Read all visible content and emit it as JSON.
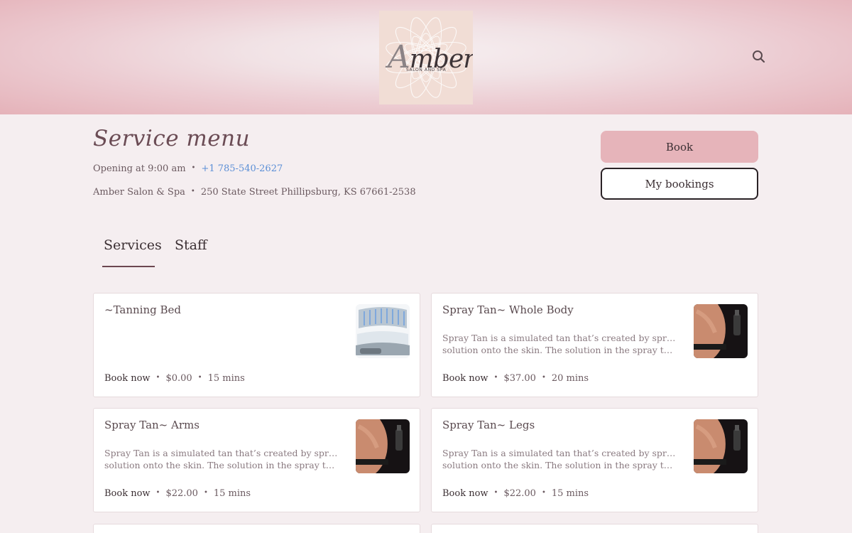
{
  "header": {
    "logo_word": "mber",
    "logo_initial": "A",
    "logo_sub": "SALON AND SPA"
  },
  "service": {
    "title": "Service menu",
    "opening": "Opening at 9:00 am",
    "phone": "+1 785-540-2627",
    "business_name": "Amber Salon & Spa",
    "address": "250 State Street Phillipsburg, KS 67661-2538",
    "separator": "•"
  },
  "actions": {
    "book": "Book",
    "my_bookings": "My bookings"
  },
  "tabs": [
    {
      "label": "Services",
      "active": true
    },
    {
      "label": "Staff",
      "active": false
    }
  ],
  "cards": [
    {
      "name": "~Tanning Bed",
      "desc_line1": "",
      "desc_line2": "",
      "book": "Book now",
      "price": "$0.00",
      "duration": "15 mins",
      "image": "tanning-bed"
    },
    {
      "name": "Spray Tan~ Whole Body",
      "desc_line1": "Spray Tan is a simulated tan that’s created by spraying a",
      "desc_line2": "solution onto the skin. The solution in the spray tan reac…",
      "book": "Book now",
      "price": "$37.00",
      "duration": "20 mins",
      "image": "spray-tan"
    },
    {
      "name": "Spray Tan~ Arms",
      "desc_line1": "Spray Tan is a simulated tan that’s created by spraying a",
      "desc_line2": "solution onto the skin. The solution in the spray tan reac…",
      "book": "Book now",
      "price": "$22.00",
      "duration": "15 mins",
      "image": "spray-tan"
    },
    {
      "name": "Spray Tan~ Legs",
      "desc_line1": "Spray Tan is a simulated tan that’s created by spraying a",
      "desc_line2": "solution onto the skin. The solution in the spray tan reac…",
      "book": "Book now",
      "price": "$22.00",
      "duration": "15 mins",
      "image": "spray-tan"
    }
  ],
  "colors": {
    "accent_pink": "#e6b4ba",
    "title": "#6b4c55",
    "link": "#5b8fd6",
    "page_bg": "#f5eef0"
  }
}
